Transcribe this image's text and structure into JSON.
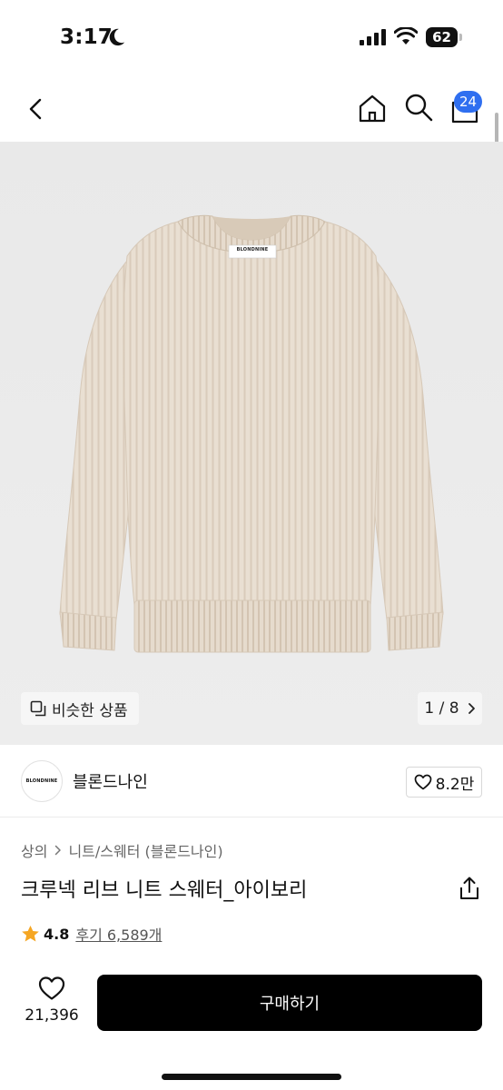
{
  "status_bar": {
    "time": "3:17",
    "battery": "62"
  },
  "nav": {
    "cart_count": "24"
  },
  "product_image": {
    "brand_label": "BLONDNINE",
    "similar_label": "비슷한 상품",
    "pager": "1 / 8"
  },
  "brand": {
    "logo_text": "BLONDNINE",
    "name": "블론드나인",
    "likes": "8.2만"
  },
  "product": {
    "breadcrumb": [
      "상의",
      "니트/스웨터 (블론드나인)"
    ],
    "title": "크루넥 리브 니트 스웨터_아이보리",
    "rating": "4.8",
    "reviews": "후기 6,589개"
  },
  "bottom_bar": {
    "wish_count": "21,396",
    "buy_label": "구매하기"
  },
  "colors": {
    "accent": "#2f6ff0",
    "star": "#f5a623",
    "sweater": "#e8ddd0",
    "buy_button": "#000000"
  },
  "icons": [
    "moon-icon",
    "signal-icon",
    "wifi-icon",
    "battery-icon",
    "back-icon",
    "home-icon",
    "search-icon",
    "cart-icon",
    "similar-icon",
    "chevron-right-icon",
    "heart-icon",
    "share-icon",
    "star-icon"
  ]
}
